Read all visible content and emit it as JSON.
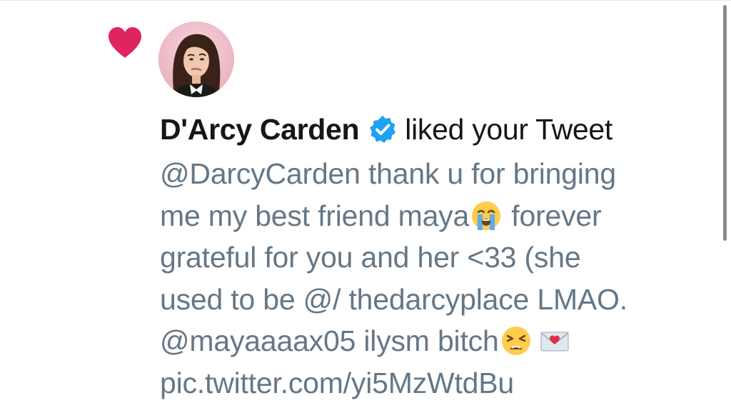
{
  "notification": {
    "type_icon": "heart-icon",
    "type_icon_color": "#e0245e",
    "avatar_alt": "D'Arcy Carden profile photo",
    "actor_name": "D'Arcy Carden",
    "verified_icon": "verified-badge-icon",
    "verified_color": "#1da1f2",
    "action_text": "liked your Tweet",
    "tweet_lines": [
      "@DarcyCarden thank u for bringing",
      "me my best friend maya",
      " forever",
      "grateful for you and her <33 (she",
      "used to be @/ thedarcyplace LMAO.",
      "@mayaaaax05 ilysm bitch",
      "pic.twitter.com/yi5MzWtdBu"
    ],
    "emojis": [
      "loudly-crying-face-emoji",
      "weary-face-emoji",
      "love-letter-emoji"
    ]
  },
  "colors": {
    "name_text": "#14171a",
    "tweet_text": "#657786",
    "background": "#ffffff"
  },
  "scrollbar": {
    "visible": true
  }
}
